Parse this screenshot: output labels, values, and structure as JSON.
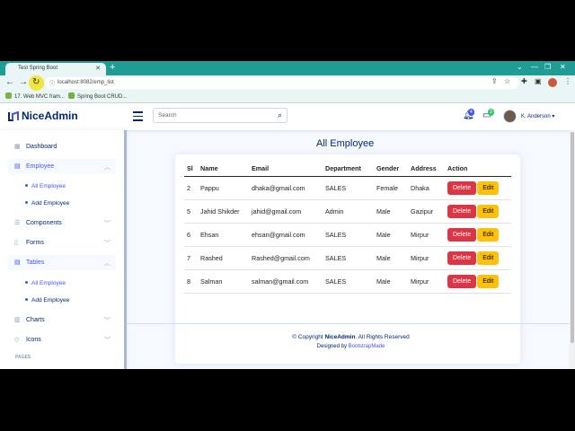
{
  "browser": {
    "tab_title": "Test Spring Boot",
    "url": "localhost:8082/emp_list",
    "bookmarks": [
      "17. Web MVC fram...",
      "Spring Boot CRUD..."
    ]
  },
  "header": {
    "logo": "NiceAdmin",
    "search_placeholder": "Search",
    "notifications_count": "4",
    "messages_count": "3",
    "user_name": "K. Anderson ▾"
  },
  "sidebar": {
    "dashboard": "Dashboard",
    "employee": "Employee",
    "employee_sub": [
      "All Employee",
      "Add Employee"
    ],
    "components": "Components",
    "forms": "Forms",
    "tables": "Tables",
    "tables_sub": [
      "All Employee",
      "Add Employee"
    ],
    "charts": "Charts",
    "icons": "Icons",
    "pages_heading": "PAGES"
  },
  "main": {
    "title": "All Employee",
    "columns": [
      "Sl",
      "Name",
      "Email",
      "Department",
      "Gender",
      "Address",
      "Action"
    ],
    "rows": [
      {
        "sl": "2",
        "name": "Pappu",
        "email": "dhaka@gmail.com",
        "dept": "SALES",
        "gender": "Female",
        "address": "Dhaka"
      },
      {
        "sl": "5",
        "name": "Jahid Shikder",
        "email": "jahid@gmail.com",
        "dept": "Admin",
        "gender": "Male",
        "address": "Gazipur"
      },
      {
        "sl": "6",
        "name": "Ehsan",
        "email": "ehsan@gmail.com",
        "dept": "SALES",
        "gender": "Male",
        "address": "Mirpur"
      },
      {
        "sl": "7",
        "name": "Rashed",
        "email": "Rashed@gmail.com",
        "dept": "SALES",
        "gender": "Male",
        "address": "Mirpur"
      },
      {
        "sl": "8",
        "name": "Salman",
        "email": "salman@gmail.com",
        "dept": "SALES",
        "gender": "Male",
        "address": "Mirpur"
      }
    ],
    "delete_label": "Delete",
    "edit_label": "Edit"
  },
  "footer": {
    "copyright_prefix": "© Copyright ",
    "brand": "NiceAdmin",
    "copyright_suffix": ". All Rights Reserved",
    "designed_by": "Designed by ",
    "designer": "BootstrapMade"
  },
  "colors": {
    "primary": "#4154f1",
    "navy": "#012970",
    "danger": "#dc3545",
    "warning": "#ffc107",
    "chrome": "#1f9c93"
  },
  "icons": [
    "reload-icon",
    "search-icon",
    "bell-icon",
    "chat-icon",
    "grid-icon",
    "menu-icon"
  ]
}
